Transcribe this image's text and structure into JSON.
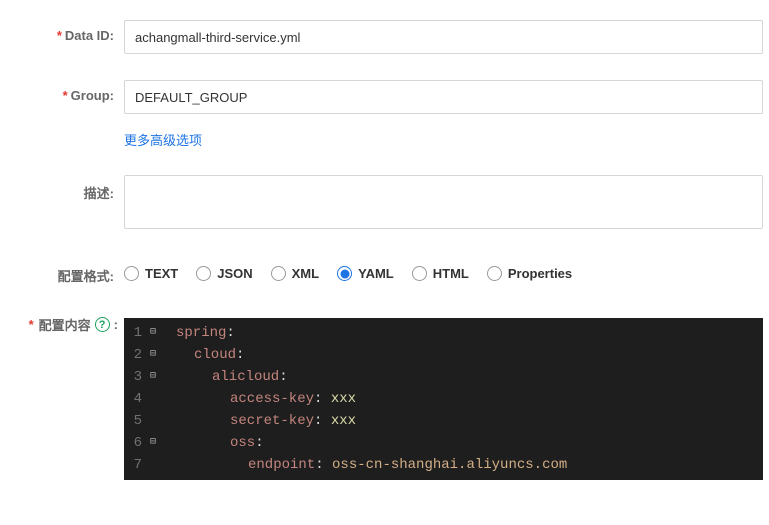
{
  "labels": {
    "data_id": "Data ID:",
    "group": "Group:",
    "advanced": "更多高级选项",
    "description": "描述:",
    "format": "配置格式:",
    "content": "配置内容"
  },
  "fields": {
    "data_id_value": "achangmall-third-service.yml",
    "group_value": "DEFAULT_GROUP",
    "description_value": ""
  },
  "format_options": [
    {
      "label": "TEXT",
      "selected": false
    },
    {
      "label": "JSON",
      "selected": false
    },
    {
      "label": "XML",
      "selected": false
    },
    {
      "label": "YAML",
      "selected": true
    },
    {
      "label": "HTML",
      "selected": false
    },
    {
      "label": "Properties",
      "selected": false
    }
  ],
  "code": {
    "lines": [
      {
        "n": 1,
        "fold": true,
        "indent": 0,
        "key": "spring",
        "val": ""
      },
      {
        "n": 2,
        "fold": true,
        "indent": 1,
        "key": "cloud",
        "val": ""
      },
      {
        "n": 3,
        "fold": true,
        "indent": 2,
        "key": "alicloud",
        "val": ""
      },
      {
        "n": 4,
        "fold": false,
        "indent": 3,
        "key": "access-key",
        "val": "xxx"
      },
      {
        "n": 5,
        "fold": false,
        "indent": 3,
        "key": "secret-key",
        "val": "xxx"
      },
      {
        "n": 6,
        "fold": true,
        "indent": 3,
        "key": "oss",
        "val": ""
      },
      {
        "n": 7,
        "fold": false,
        "indent": 4,
        "key": "endpoint",
        "val": "oss-cn-shanghai.aliyuncs.com"
      }
    ]
  }
}
